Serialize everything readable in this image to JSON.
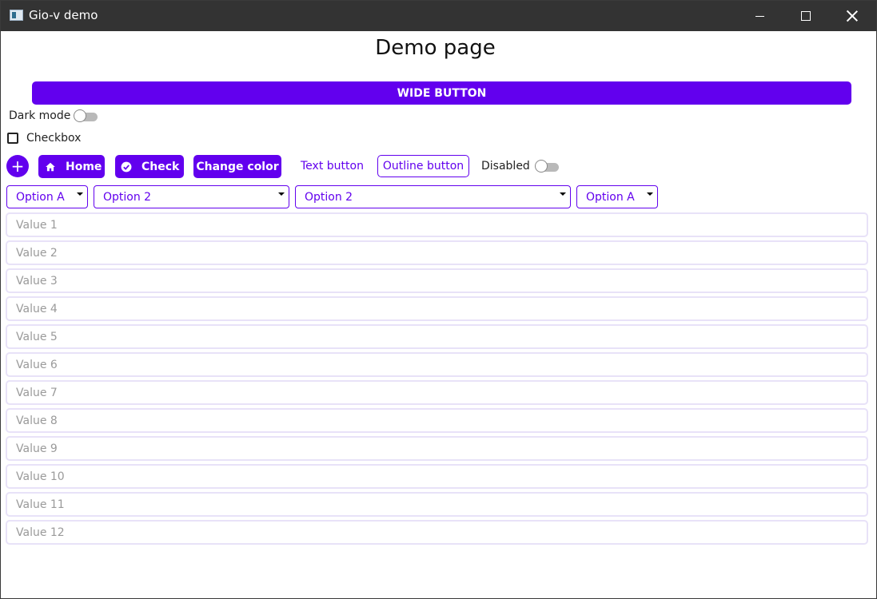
{
  "window": {
    "title": "Gio-v demo",
    "controls": [
      "minimize-icon",
      "maximize-icon",
      "close-icon"
    ]
  },
  "page": {
    "title": "Demo page"
  },
  "buttons": {
    "wide": "WIDE BUTTON",
    "fab_icon": "plus-icon",
    "home": "Home",
    "check": "Check",
    "change_color": "Change color",
    "text": "Text button",
    "outline": "Outline button"
  },
  "toggles": {
    "dark_mode": {
      "label": "Dark mode",
      "on": false
    },
    "disabled": {
      "label": "Disabled",
      "on": false
    }
  },
  "checkbox": {
    "label": "Checkbox",
    "checked": false
  },
  "dropdowns": [
    {
      "selected": "Option A"
    },
    {
      "selected": "Option 2"
    },
    {
      "selected": "Option 2"
    },
    {
      "selected": "Option A"
    }
  ],
  "values": [
    "Value 1",
    "Value 2",
    "Value 3",
    "Value 4",
    "Value 5",
    "Value 6",
    "Value 7",
    "Value 8",
    "Value 9",
    "Value 10",
    "Value 11",
    "Value 12"
  ],
  "colors": {
    "primary": "#6200ee",
    "titlebar": "#333333",
    "field_border": "#e8e2f8",
    "placeholder_text": "#9a9a9a"
  }
}
